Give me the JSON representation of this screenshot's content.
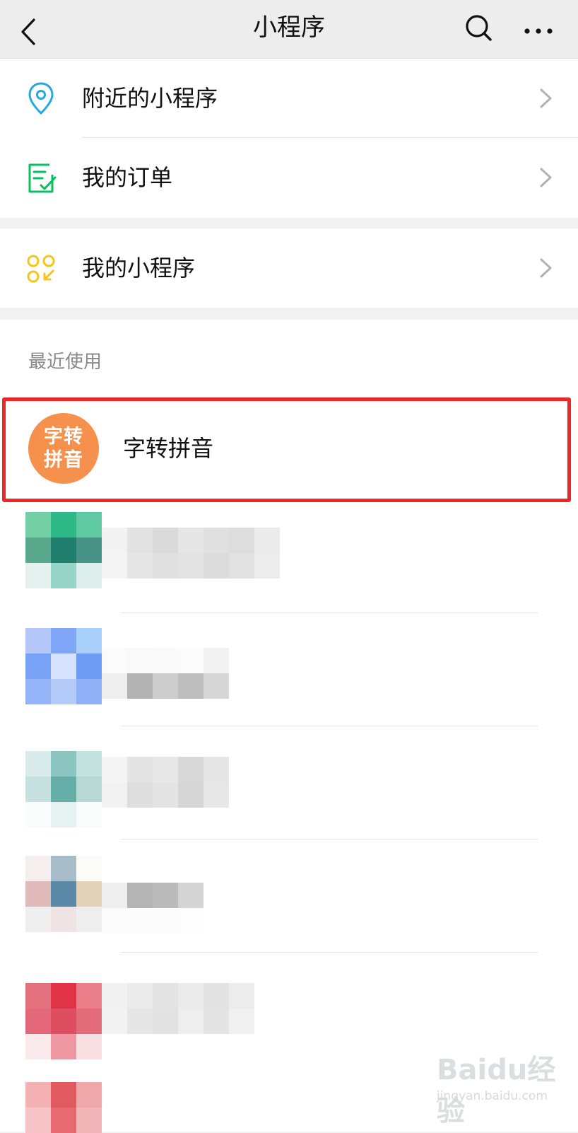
{
  "navbar": {
    "title": "小程序",
    "back_icon": "chevron-left-icon",
    "search_icon": "search-icon",
    "more_icon": "more-icon"
  },
  "menu": {
    "items": [
      {
        "label": "附近的小程序",
        "icon": "location-pin-icon",
        "icon_color": "#22a8e0"
      },
      {
        "label": "我的订单",
        "icon": "order-list-icon",
        "icon_color": "#07c160"
      },
      {
        "label": "我的小程序",
        "icon": "my-miniprogram-icon",
        "icon_color": "#f5c518"
      }
    ]
  },
  "recent": {
    "title": "最近使用",
    "apps": [
      {
        "name": "字转拼音",
        "logo_text": "字转拼音",
        "logo_color": "#f5914d",
        "highlighted": true
      }
    ]
  },
  "colors": {
    "highlight_border": "#f02525",
    "nav_background": "#ededed"
  },
  "watermark": {
    "brand": "Baidu经验",
    "url": "jingyan.baidu.com"
  }
}
